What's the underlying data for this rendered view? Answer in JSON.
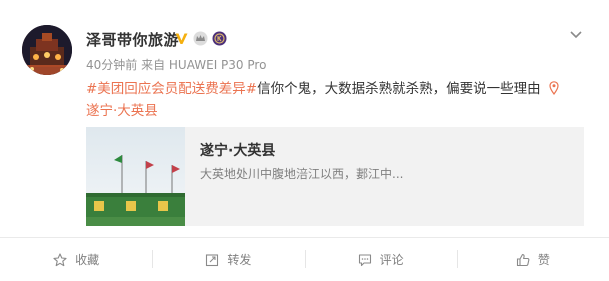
{
  "post": {
    "author": "泽哥带你旅游",
    "meta": "40分钟前 来自 HUAWEI P30 Pro",
    "topic": "#美团回应会员配送费差异#",
    "text": "信你个鬼，大数据杀熟就杀熟，偏要说一些理由",
    "location": "遂宁·大英县"
  },
  "link_card": {
    "title": "遂宁·大英县",
    "description": "大英地处川中腹地涪江以西，郪江中..."
  },
  "actions": {
    "favorite": "收藏",
    "repost": "转发",
    "comment": "评论",
    "like": "赞"
  },
  "colors": {
    "accent": "#eb7350",
    "verified_badge": "#f5b00f",
    "meta_text": "#939393",
    "card_bg": "#f2f2f2"
  },
  "icons": {
    "verified": "verified-v-icon",
    "crown": "crown-icon",
    "member": "member-badge-icon",
    "menu": "chevron-down-icon",
    "location": "location-pin-icon",
    "favorite": "star-icon",
    "repost": "repost-icon",
    "comment": "comment-icon",
    "like": "thumbs-up-icon"
  }
}
